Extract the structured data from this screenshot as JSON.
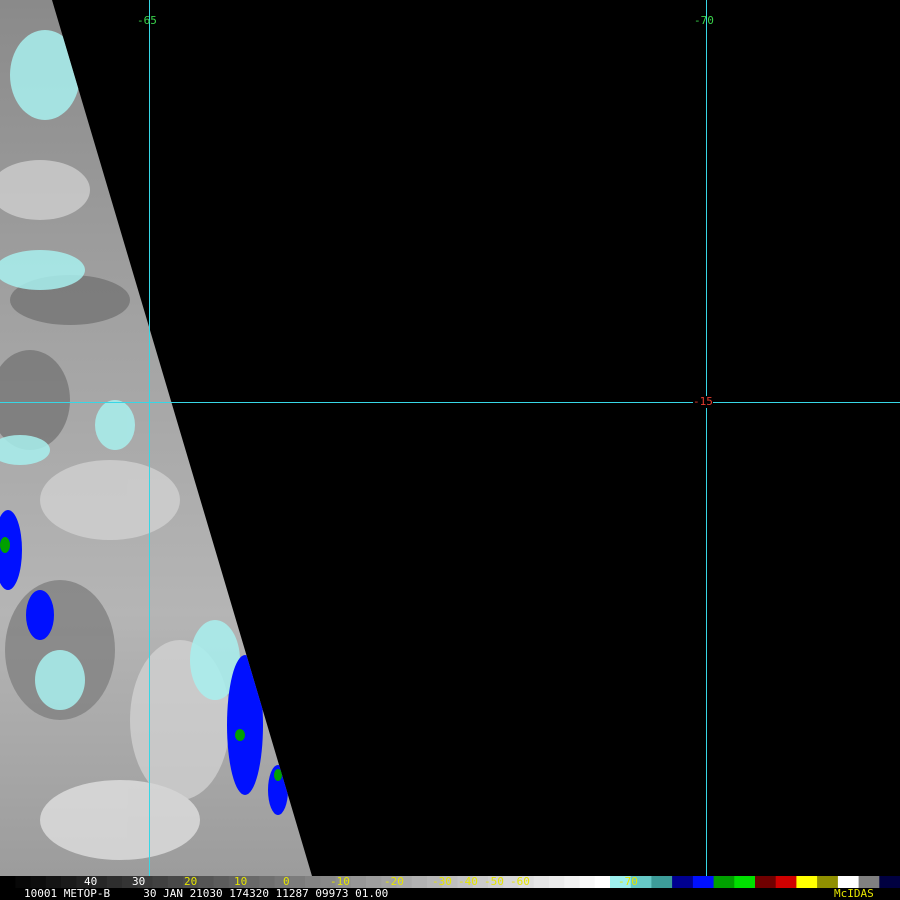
{
  "grid": {
    "lon_labels": [
      "-65",
      "-70"
    ],
    "lat_labels": [
      "-15"
    ],
    "line_color": "#37d7e6",
    "lon_label_color": "#39d24b",
    "lat_label_color": "#e63b2e"
  },
  "colorbar": {
    "ticks": [
      "40",
      "30",
      "20",
      "10",
      "0",
      "-10",
      "-20",
      "-30",
      "-40",
      "-50",
      "-60",
      "-70"
    ],
    "colors": [
      "#000000",
      "#1e1e1e",
      "#3a3a3a",
      "#565656",
      "#727272",
      "#8e8e8e",
      "#aaaaaa",
      "#c6c6c6",
      "#e2e2e2",
      "#ffffff",
      "#9ef0ee",
      "#66c9c6",
      "#3d9c99",
      "#000090",
      "#0010ff",
      "#00a000",
      "#00e000",
      "#700000",
      "#d00000",
      "#ffff00",
      "#909000",
      "#ffffff",
      "#808080",
      "#000040"
    ]
  },
  "footer": {
    "info": "10001 METOP-B     30 JAN 21030 174320 11287 09973 01.00",
    "brand": "McIDAS"
  }
}
